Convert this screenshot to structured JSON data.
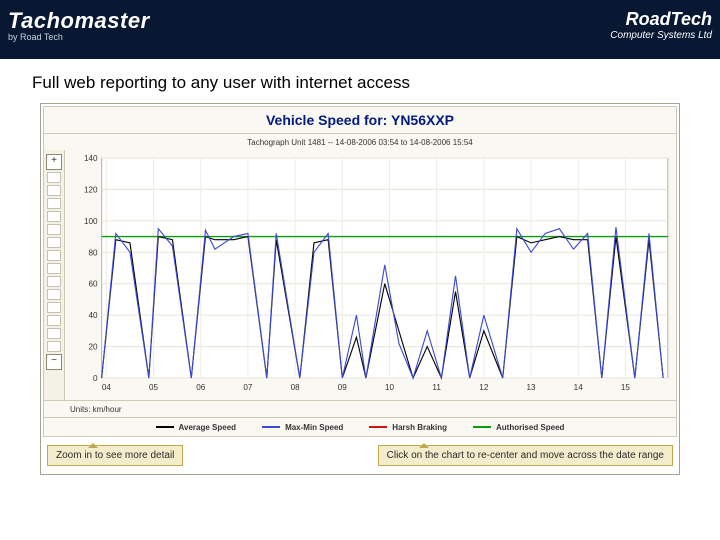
{
  "brand": {
    "main": "Tachomaster",
    "sub": "by Road Tech",
    "right1": "RoadTech",
    "right2": "Computer Systems Ltd"
  },
  "heading": "Full web reporting to any user with internet access",
  "chart_data": {
    "type": "line",
    "title": "Vehicle Speed for: YN56XXP",
    "subtitle": "Tachograph Unit 1481 -- 14-08-2006 03:54 to 14-08-2006 15:54",
    "ylabel": "",
    "xlabel": "",
    "ylim": [
      0,
      140
    ],
    "yticks": [
      0,
      20,
      40,
      60,
      80,
      100,
      120,
      140
    ],
    "xticks": [
      "04",
      "05",
      "06",
      "07",
      "08",
      "09",
      "10",
      "11",
      "12",
      "13",
      "14",
      "15"
    ],
    "authorised_speed": 90,
    "units": "Units: km/hour",
    "series": [
      {
        "name": "Average Speed",
        "color": "#000000",
        "x": [
          3.9,
          4.2,
          4.5,
          4.9,
          5.1,
          5.4,
          5.8,
          6.1,
          6.3,
          6.7,
          7.0,
          7.4,
          7.6,
          8.1,
          8.4,
          8.7,
          9.0,
          9.3,
          9.5,
          9.9,
          10.2,
          10.5,
          10.8,
          11.1,
          11.4,
          11.7,
          12.0,
          12.4,
          12.7,
          13.0,
          13.3,
          13.6,
          13.9,
          14.2,
          14.5,
          14.8,
          15.2,
          15.5,
          15.8
        ],
        "y": [
          0,
          88,
          86,
          0,
          90,
          88,
          0,
          90,
          88,
          88,
          90,
          0,
          88,
          0,
          86,
          88,
          0,
          26,
          0,
          60,
          30,
          0,
          20,
          0,
          55,
          0,
          30,
          0,
          90,
          86,
          88,
          90,
          88,
          88,
          0,
          90,
          0,
          88,
          0
        ]
      },
      {
        "name": "Max-Min Speed",
        "color": "#3a49d6",
        "x": [
          3.9,
          4.2,
          4.5,
          4.9,
          5.1,
          5.4,
          5.8,
          6.1,
          6.3,
          6.7,
          7.0,
          7.4,
          7.6,
          8.1,
          8.4,
          8.7,
          9.0,
          9.3,
          9.5,
          9.9,
          10.2,
          10.5,
          10.8,
          11.1,
          11.4,
          11.7,
          12.0,
          12.4,
          12.7,
          13.0,
          13.3,
          13.6,
          13.9,
          14.2,
          14.5,
          14.8,
          15.2,
          15.5,
          15.8
        ],
        "y": [
          0,
          92,
          80,
          0,
          95,
          84,
          0,
          94,
          82,
          90,
          92,
          0,
          92,
          0,
          80,
          92,
          0,
          40,
          0,
          72,
          22,
          0,
          30,
          0,
          65,
          0,
          40,
          0,
          95,
          80,
          92,
          95,
          82,
          92,
          0,
          96,
          0,
          92,
          0
        ]
      },
      {
        "name": "Harsh Braking",
        "color": "#d11313",
        "x": [],
        "y": []
      },
      {
        "name": "Authorised Speed",
        "color": "#0b9c0b",
        "x": [
          3.9,
          15.9
        ],
        "y": [
          90,
          90
        ]
      }
    ],
    "legend": [
      "Average Speed",
      "Max-Min Speed",
      "Harsh Braking",
      "Authorised Speed"
    ]
  },
  "sidebar": {
    "zoom_in": "+",
    "zoom_out": "−"
  },
  "tips": {
    "left": "Zoom in to see more detail",
    "right": "Click on the chart to re-center and move across the date range"
  }
}
